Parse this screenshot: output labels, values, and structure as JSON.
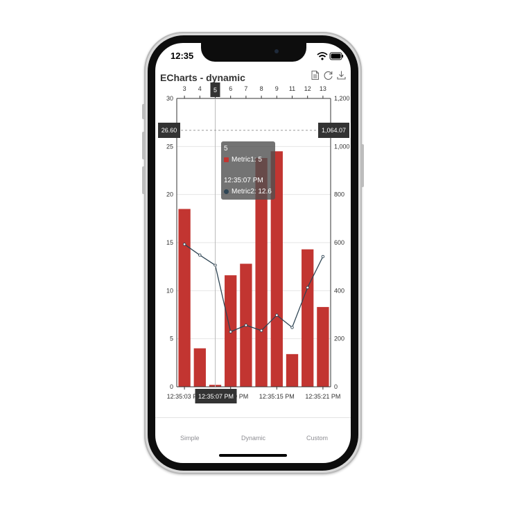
{
  "status_bar": {
    "time": "12:35",
    "icons": [
      "wifi-icon",
      "battery-icon"
    ]
  },
  "toolbox": {
    "icons": [
      "data-view-icon",
      "restore-icon",
      "save-image-icon"
    ]
  },
  "tooltip": {
    "header": "5",
    "metric1": "Metric1: 5",
    "time": "12:35:07 PM",
    "metric2": "Metric2: 12.6"
  },
  "axis_pointer": {
    "top_category": "5",
    "bottom_time": "12:35:07 PM",
    "left_value": "26.60",
    "right_value": "1,064.07"
  },
  "tabs": [
    {
      "label": "Simple"
    },
    {
      "label": "Dynamic"
    },
    {
      "label": "Custom"
    }
  ],
  "colors": {
    "bar": "#c23531",
    "line": "#2f4554",
    "tooltip_bg": "#505050",
    "pointer_label": "#333333"
  },
  "chart_data": {
    "type": "bar",
    "title": "ECharts - dynamic",
    "categories": [
      "3",
      "4",
      "5",
      "6",
      "7",
      "8",
      "9",
      "11",
      "12",
      "13"
    ],
    "time_ticks": [
      "12:35:03 PM",
      "12:35:09 PM",
      "12:35:15 PM",
      "12:35:21 PM"
    ],
    "time_tick_index": [
      0,
      3,
      6,
      9
    ],
    "series": [
      {
        "name": "Metric1",
        "type": "bar",
        "axis": "left",
        "values": [
          18.5,
          4,
          0.2,
          11.6,
          12.8,
          23.8,
          24.5,
          3.4,
          14.3,
          8.3
        ]
      },
      {
        "name": "Metric2",
        "type": "line",
        "axis": "right",
        "values": [
          593,
          548,
          506,
          229,
          256,
          234,
          298,
          247,
          413,
          542
        ]
      }
    ],
    "y_left": {
      "min": 0,
      "max": 30,
      "ticks": [
        "0",
        "5",
        "10",
        "15",
        "20",
        "25",
        "30"
      ]
    },
    "y_right": {
      "min": 0,
      "max": 1200,
      "ticks": [
        "0",
        "200",
        "400",
        "600",
        "800",
        "1,000",
        "1,200"
      ]
    },
    "grid": true,
    "legend": "none"
  }
}
